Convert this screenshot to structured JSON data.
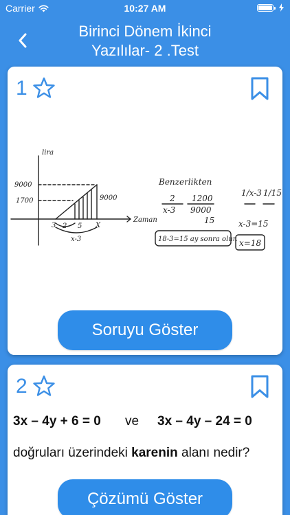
{
  "status_bar": {
    "carrier": "Carrier",
    "time": "10:27 AM"
  },
  "nav": {
    "title_line1": "Birinci Dönem İkinci",
    "title_line2": "Yazılılar- 2 .Test"
  },
  "colors": {
    "accent": "#3b8fe6",
    "button": "#2f8de9",
    "card": "#ffffff"
  },
  "questions": [
    {
      "number": "1",
      "button_label": "Soruyu Göster",
      "handwriting": {
        "axis_y": "lira",
        "axis_x": "Zaman",
        "y_ticks": [
          "9000",
          "1700"
        ],
        "x_ticks": [
          "3",
          "X"
        ],
        "dim_labels": [
          "2",
          "5",
          "x-3"
        ],
        "bar_label": "9000",
        "heading": "Benzerlikten",
        "eq1_left_num": "2",
        "eq1_left_den": "x-3",
        "eq1_right_num": "1200",
        "eq1_right_den": "9000",
        "eq1_result": "15",
        "box1": "18-3=15 ay sonra olur.",
        "eq2_left": "1/x-3",
        "eq2_right": "1/15",
        "eq3": "x-3=15",
        "box2": "x=18"
      }
    },
    {
      "number": "2",
      "button_label": "Çözümü Göster",
      "equation_left": "3x – 4y + 6 = 0",
      "equation_connector": "ve",
      "equation_right": "3x – 4y – 24 = 0",
      "text_before": "doğruları üzerindeki ",
      "text_bold": "karenin",
      "text_after": " alanı nedir?"
    }
  ]
}
